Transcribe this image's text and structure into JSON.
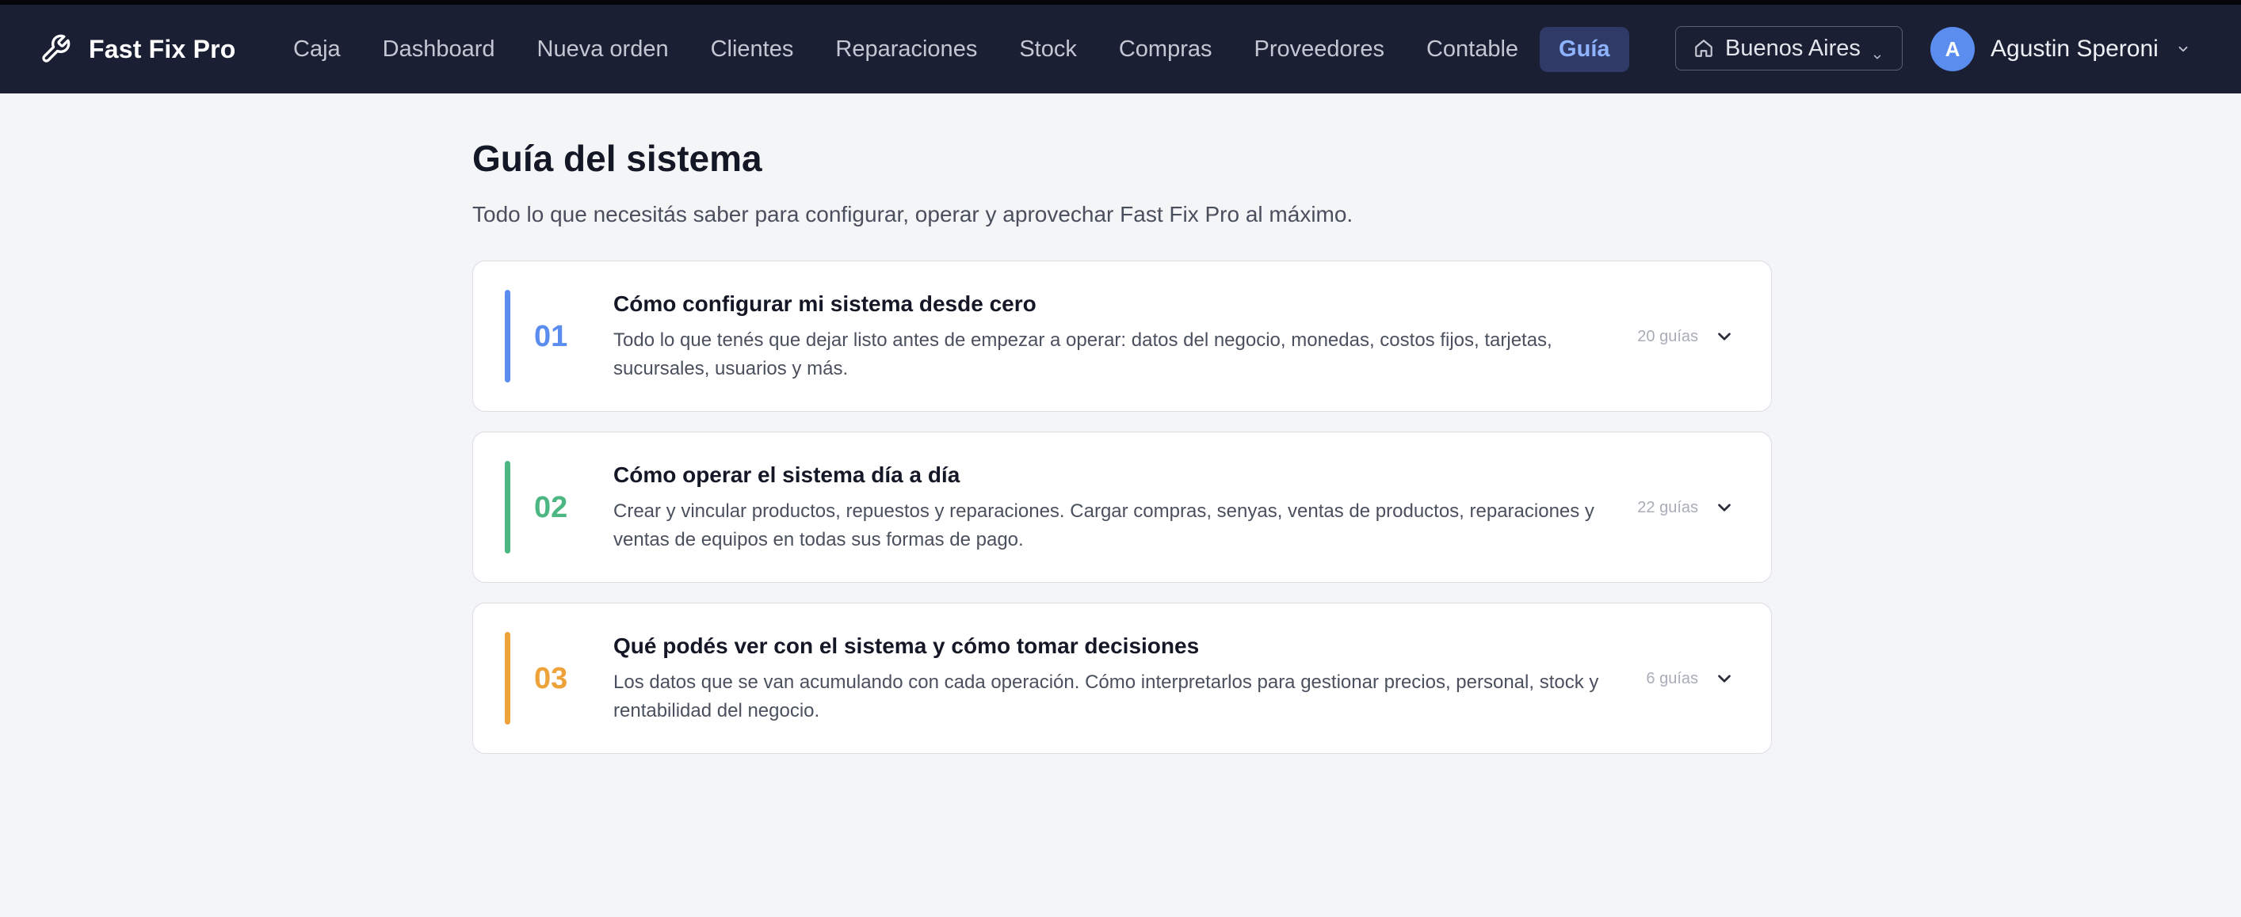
{
  "brand": {
    "name": "Fast Fix Pro",
    "icon": "wrench-icon"
  },
  "nav": {
    "items": [
      {
        "label": "Caja",
        "active": false
      },
      {
        "label": "Dashboard",
        "active": false
      },
      {
        "label": "Nueva orden",
        "active": false
      },
      {
        "label": "Clientes",
        "active": false
      },
      {
        "label": "Reparaciones",
        "active": false
      },
      {
        "label": "Stock",
        "active": false
      },
      {
        "label": "Compras",
        "active": false
      },
      {
        "label": "Proveedores",
        "active": false
      },
      {
        "label": "Contable",
        "active": false
      },
      {
        "label": "Guía",
        "active": true
      }
    ]
  },
  "branch": {
    "label": "Buenos Aires",
    "icon": "house-icon"
  },
  "user": {
    "initial": "A",
    "name": "Agustin Speroni"
  },
  "page": {
    "title": "Guía del sistema",
    "subtitle": "Todo lo que necesitás saber para configurar, operar y aprovechar Fast Fix Pro al máximo."
  },
  "sections": [
    {
      "number": "01",
      "color": "#5b8def",
      "title": "Cómo configurar mi sistema desde cero",
      "description": "Todo lo que tenés que dejar listo antes de empezar a operar: datos del negocio, monedas, costos fijos, tarjetas, sucursales, usuarios y más.",
      "count": "20 guías"
    },
    {
      "number": "02",
      "color": "#4cb782",
      "title": "Cómo operar el sistema día a día",
      "description": "Crear y vincular productos, repuestos y reparaciones. Cargar compras, senyas, ventas de productos, reparaciones y ventas de equipos en todas sus formas de pago.",
      "count": "22 guías"
    },
    {
      "number": "03",
      "color": "#eda23a",
      "title": "Qué podés ver con el sistema y cómo tomar decisiones",
      "description": "Los datos que se van acumulando con cada operación. Cómo interpretarlos para gestionar precios, personal, stock y rentabilidad del negocio.",
      "count": "6 guías"
    }
  ]
}
